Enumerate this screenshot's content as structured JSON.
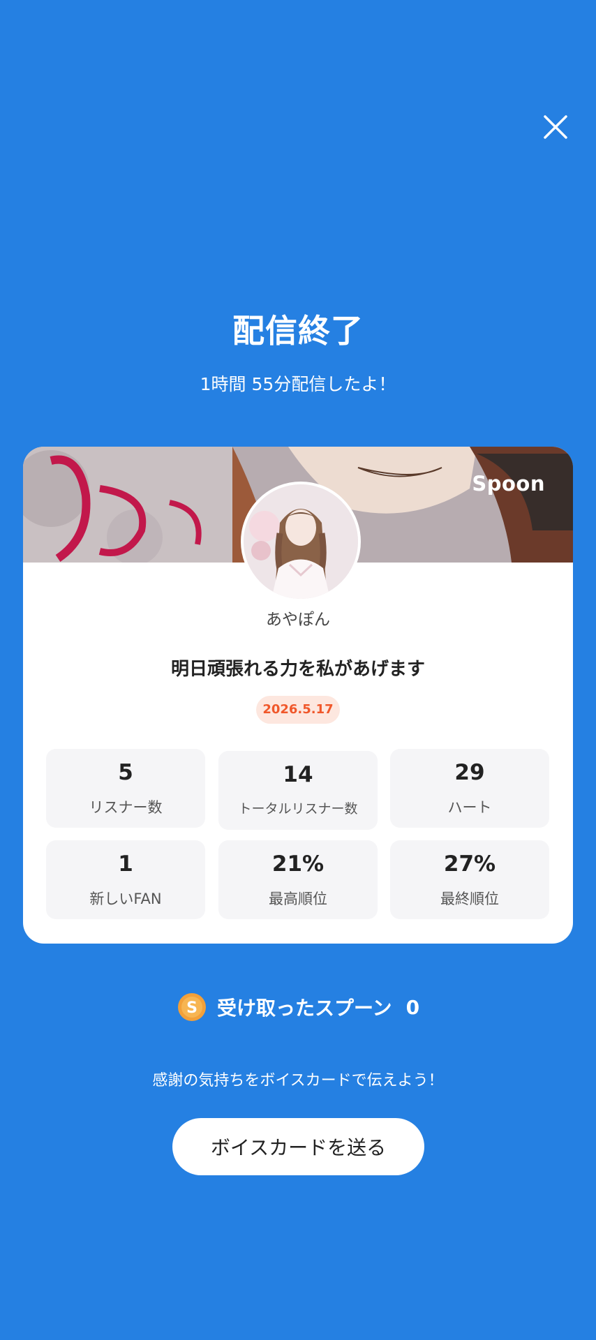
{
  "header": {
    "close_icon": "close-icon"
  },
  "summary": {
    "title": "配信終了",
    "subtitle": "1時間 55分配信したよ！"
  },
  "card": {
    "brand": "Spoon",
    "username": "あやぽん",
    "stream_title": "明日頑張れる力を私があげます",
    "date": "2026.5.17",
    "stats": [
      {
        "value": "5",
        "label": "リスナー数"
      },
      {
        "value": "14",
        "label": "トータルリスナー数"
      },
      {
        "value": "29",
        "label": "ハート"
      },
      {
        "value": "1",
        "label": "新しいFAN"
      },
      {
        "value": "21%",
        "label": "最高順位"
      },
      {
        "value": "27%",
        "label": "最終順位"
      }
    ]
  },
  "spoons": {
    "icon": "spoon-coin-icon",
    "icon_letter": "S",
    "label": "受け取ったスプーン",
    "count": "0"
  },
  "footer": {
    "thanks_text": "感謝の気持ちをボイスカードで伝えよう！",
    "voice_card_button": "ボイスカードを送る"
  },
  "colors": {
    "background": "#2580e2",
    "date_badge_text": "#f0582b",
    "date_badge_bg": "#fde7df",
    "coin": "#f2a03a"
  }
}
